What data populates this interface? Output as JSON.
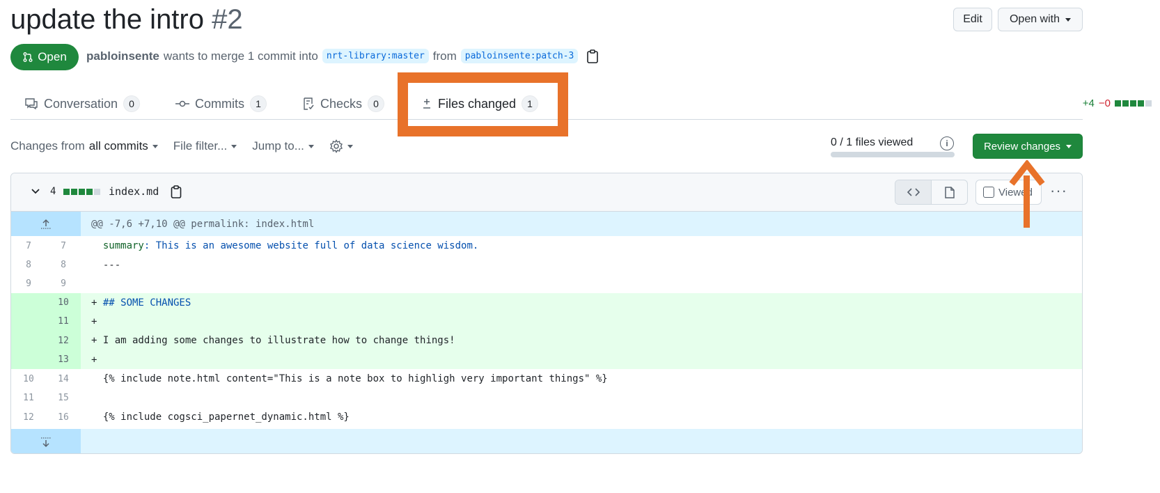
{
  "header": {
    "title": "update the intro",
    "number": "#2",
    "edit_label": "Edit",
    "open_with_label": "Open with",
    "state": "Open",
    "author": "pabloinsente",
    "merge_text": "wants to merge 1 commit into",
    "base_branch": "nrt-library:master",
    "from_text": "from",
    "head_branch": "pabloinsente:patch-3"
  },
  "tabs": [
    {
      "label": "Conversation",
      "count": "0",
      "icon": "comment-icon"
    },
    {
      "label": "Commits",
      "count": "1",
      "icon": "commit-icon"
    },
    {
      "label": "Checks",
      "count": "0",
      "icon": "checklist-icon"
    },
    {
      "label": "Files changed",
      "count": "1",
      "icon": "diff-icon",
      "selected": true
    }
  ],
  "diffstat": {
    "additions": "+4",
    "deletions": "−0"
  },
  "toolbar": {
    "changes_from": "Changes from",
    "all_commits": "all commits",
    "file_filter": "File filter...",
    "jump_to": "Jump to...",
    "files_viewed": "0 / 1 files viewed",
    "viewed_progress": 0,
    "review_label": "Review changes"
  },
  "file": {
    "change_count": "4",
    "name": "index.md",
    "viewed_label": "Viewed",
    "hunk_header": "@@ -7,6 +7,10 @@ permalink: index.html",
    "lines": [
      {
        "old": "7",
        "new": "7",
        "type": "context",
        "key": "summary",
        "rest": ": This is an awesome website full of data science wisdom."
      },
      {
        "old": "8",
        "new": "8",
        "type": "context",
        "text": "  ---"
      },
      {
        "old": "9",
        "new": "9",
        "type": "context",
        "text": ""
      },
      {
        "old": "",
        "new": "10",
        "type": "add",
        "text": "## SOME CHANGES"
      },
      {
        "old": "",
        "new": "11",
        "type": "add",
        "text": ""
      },
      {
        "old": "",
        "new": "12",
        "type": "add",
        "text": "I am adding some changes to illustrate how to change things!"
      },
      {
        "old": "",
        "new": "13",
        "type": "add",
        "text": ""
      },
      {
        "old": "10",
        "new": "14",
        "type": "context",
        "text": "  {% include note.html content=\"This is a note box to highligh very important things\" %}"
      },
      {
        "old": "11",
        "new": "15",
        "type": "context",
        "text": ""
      },
      {
        "old": "12",
        "new": "16",
        "type": "context",
        "text": "  {% include cogsci_papernet_dynamic.html %}"
      }
    ]
  },
  "colors": {
    "accent": "#1f883d",
    "annotation": "#e8722a"
  }
}
